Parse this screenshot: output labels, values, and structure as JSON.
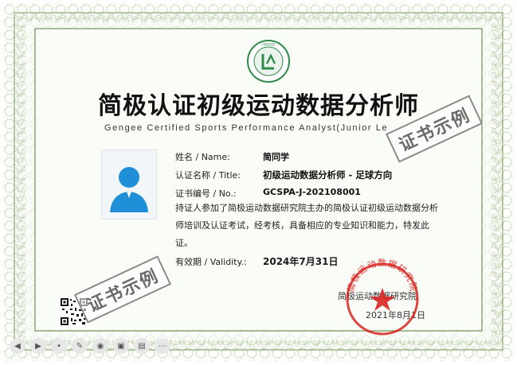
{
  "certificate": {
    "title": "简极认证初级运动数据分析师",
    "subtitle": "Gengee Certified Sports Performance Analyst(Junior Le",
    "fields": {
      "name_label": "姓名 / Name:",
      "name_value": "简同学",
      "title_label": "认证名称 / Title:",
      "title_value": "初级运动数据分析师 - 足球方向",
      "no_label": "证书编号 / No.:",
      "no_value": "GCSPA-J-202108001"
    },
    "statement": "持证人参加了简极运动数据研究院主办的简极认证初级运动数据分析师培训及认证考试，经考核，具备相应的专业知识和能力，特发此证。",
    "validity_label": "有效期 / Validity.:",
    "validity_value": "2024年7月31日",
    "issuer": "简极运动数据研究院",
    "issue_date": "2021年8月1日",
    "seal_text": "简极运动数据研究院",
    "watermark": "证书示例",
    "logo_ring_text": "简极运动数据研究院"
  },
  "colors": {
    "guilloche": "#7fa06a",
    "seal": "#d9241f",
    "avatar": "#1f8fd8"
  },
  "toolbar": {
    "icons": [
      "prev-icon",
      "play-icon",
      "next-icon",
      "pen-icon",
      "record-icon",
      "camera-icon",
      "screen-icon",
      "more-icon"
    ]
  }
}
